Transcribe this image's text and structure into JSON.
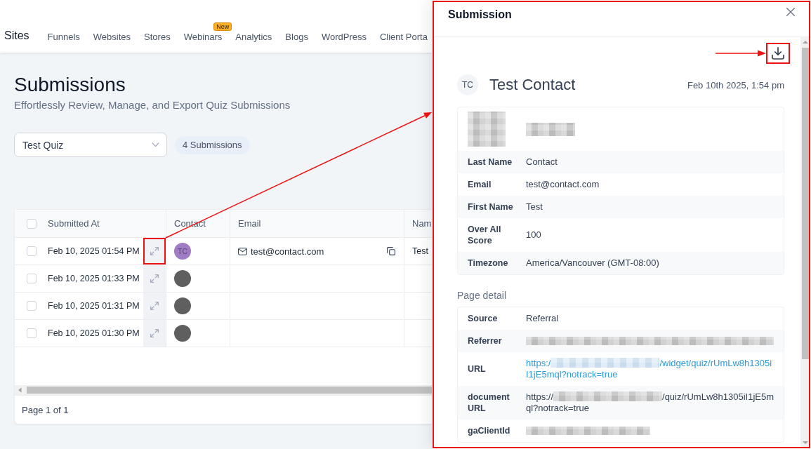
{
  "top_nav": {
    "title": "Sites",
    "items": [
      {
        "label": "Funnels"
      },
      {
        "label": "Websites"
      },
      {
        "label": "Stores"
      },
      {
        "label": "Webinars",
        "badge": "New"
      },
      {
        "label": "Analytics"
      },
      {
        "label": "Blogs"
      },
      {
        "label": "WordPress"
      },
      {
        "label": "Client Porta"
      }
    ]
  },
  "header": {
    "title": "Submissions",
    "subtitle": "Effortlessly Review, Manage, and Export Quiz Submissions"
  },
  "filters": {
    "quiz_select": {
      "value": "Test Quiz"
    },
    "count": "4 Submissions"
  },
  "table": {
    "select_all": {
      "checked": false
    },
    "columns": [
      "Submitted At",
      "Contact",
      "Email",
      "Nam"
    ],
    "rows": [
      {
        "checked": false,
        "highlighted": true,
        "submitted_at": "Feb 10, 2025 01:54 PM",
        "avatar": {
          "initials": "TC",
          "color": "#a07cc4"
        },
        "email": "test@contact.com",
        "name": "Test"
      },
      {
        "checked": false,
        "highlighted": false,
        "submitted_at": "Feb 10, 2025 01:33 PM",
        "avatar": {
          "color": "#5f5f5f"
        }
      },
      {
        "checked": false,
        "highlighted": false,
        "submitted_at": "Feb 10, 2025 01:31 PM",
        "avatar": {
          "color": "#5f5f5f"
        }
      },
      {
        "checked": false,
        "highlighted": false,
        "submitted_at": "Feb 10, 2025 01:30 PM",
        "avatar": {
          "color": "#5f5f5f"
        }
      }
    ],
    "footer": "Page 1 of 1"
  },
  "drawer": {
    "title": "Submission",
    "highlighted": true,
    "download_button": {
      "highlighted": true
    },
    "contact": {
      "initials": "TC",
      "name": "Test Contact",
      "date": "Feb 10th 2025, 1:54 pm"
    },
    "fields": [
      {
        "kind": "blurred"
      },
      {
        "kind": "text",
        "label": "Last Name",
        "value": "Contact"
      },
      {
        "kind": "text",
        "label": "Email",
        "value": "test@contact.com"
      },
      {
        "kind": "text",
        "label": "First Name",
        "value": "Test"
      },
      {
        "kind": "text",
        "label": "Over All Score",
        "value": "100"
      },
      {
        "kind": "text",
        "label": "Timezone",
        "value": "America/Vancouver (GMT-08:00)"
      }
    ],
    "page_detail": {
      "title": "Page detail",
      "fields": [
        {
          "kind": "text",
          "label": "Source",
          "value": "Referral"
        },
        {
          "kind": "blurred_value",
          "label": "Referrer"
        },
        {
          "kind": "link",
          "label": "URL",
          "prefix": "https:/",
          "suffix": "/widget/quiz/rUmLw8h1305iI1jE5mql?notrack=true"
        },
        {
          "kind": "partly_blurred",
          "label": "document URL",
          "prefix": "https://",
          "suffix": "/quiz/rUmLw8h1305iI1jE5mql?notrack=true"
        },
        {
          "kind": "blurred_value",
          "label": "gaClientId"
        }
      ]
    }
  }
}
